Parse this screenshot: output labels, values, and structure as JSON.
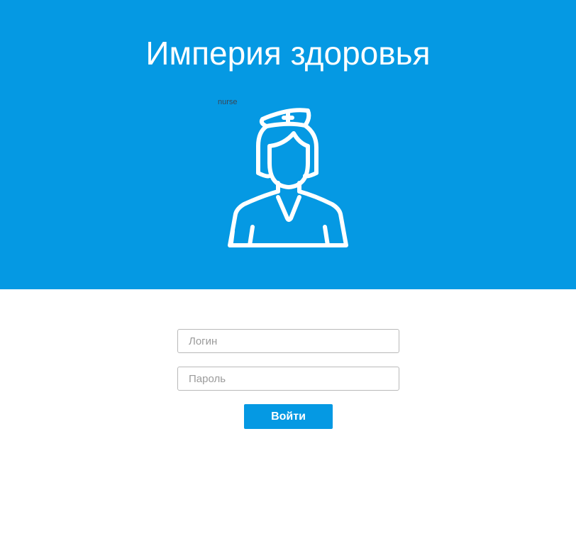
{
  "header": {
    "title": "Империя здоровья",
    "image_alt": "nurse",
    "icon": "nurse-icon",
    "background_color": "#0599e3"
  },
  "login_form": {
    "login_placeholder": "Логин",
    "password_placeholder": "Пароль",
    "submit_label": "Войти",
    "button_color": "#0599e3"
  }
}
